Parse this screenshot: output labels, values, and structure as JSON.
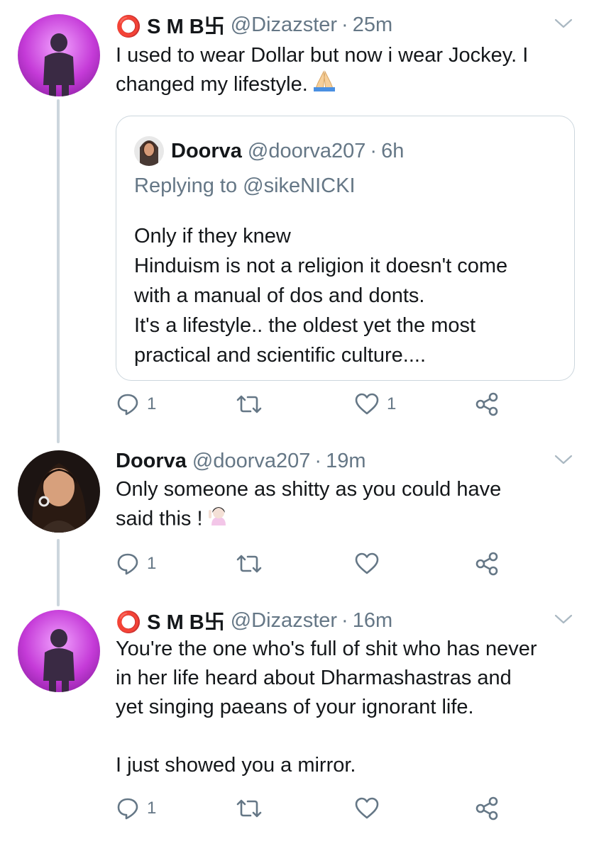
{
  "tweets": [
    {
      "name": "⭕ S M B卐",
      "handle": "@Dizazster",
      "dot": "·",
      "time": "25m",
      "text": "I used to wear Dollar but now i wear Jockey. I\nchanged my lifestyle.",
      "emoji": "folded-hands",
      "quote": {
        "name": "Doorva",
        "handle": "@doorva207",
        "dot": "·",
        "time": "6h",
        "replying": "Replying to @sikeNICKI",
        "text": "Only if they knew\nHinduism is not a religion it doesn't come\nwith a manual of dos and donts.\nIt's a lifestyle.. the oldest yet the most\npractical and scientific culture...."
      },
      "actions": {
        "replies": "1",
        "retweets": "",
        "likes": "1"
      }
    },
    {
      "name": "Doorva",
      "handle": "@doorva207",
      "dot": "·",
      "time": "19m",
      "text": "Only someone as shitty as you could have\nsaid this !",
      "emoji": "woman-raising-hand",
      "actions": {
        "replies": "1",
        "retweets": "",
        "likes": ""
      }
    },
    {
      "name": "⭕ S M B卐",
      "handle": "@Dizazster",
      "dot": "·",
      "time": "16m",
      "text": "You're the one who's full of shit who has never\nin her life heard about Dharmashastras and\nyet singing paeans of your ignorant life.\n\nI just showed you a mirror.",
      "actions": {
        "replies": "1",
        "retweets": "",
        "likes": ""
      }
    }
  ],
  "colors": {
    "text": "#14171a",
    "secondary": "#657786",
    "border": "#ccd6dd",
    "thread_line": "#ccd6dd"
  }
}
